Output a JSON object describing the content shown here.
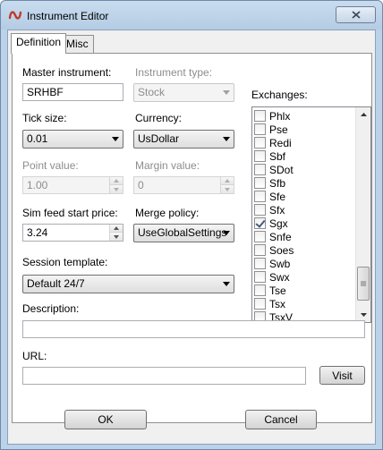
{
  "window": {
    "title": "Instrument Editor",
    "close_label": "X"
  },
  "tabs": [
    {
      "label": "Definition",
      "active": true
    },
    {
      "label": "Misc",
      "active": false
    }
  ],
  "fields": {
    "master_instrument": {
      "label": "Master instrument:",
      "value": "SRHBF"
    },
    "instrument_type": {
      "label": "Instrument type:",
      "value": "Stock"
    },
    "tick_size": {
      "label": "Tick size:",
      "value": "0.01"
    },
    "currency": {
      "label": "Currency:",
      "value": "UsDollar"
    },
    "point_value": {
      "label": "Point value:",
      "value": "1.00"
    },
    "margin_value": {
      "label": "Margin value:",
      "value": "0"
    },
    "sim_feed_start_price": {
      "label": "Sim feed start price:",
      "value": "3.24"
    },
    "merge_policy": {
      "label": "Merge policy:",
      "value": "UseGlobalSettings"
    },
    "session_template": {
      "label": "Session template:",
      "value": "Default 24/7"
    },
    "description": {
      "label": "Description:",
      "value": ""
    },
    "url": {
      "label": "URL:",
      "value": ""
    }
  },
  "exchanges": {
    "label": "Exchanges:",
    "items": [
      {
        "name": "Phlx",
        "checked": false
      },
      {
        "name": "Pse",
        "checked": false
      },
      {
        "name": "Redi",
        "checked": false
      },
      {
        "name": "Sbf",
        "checked": false
      },
      {
        "name": "SDot",
        "checked": false
      },
      {
        "name": "Sfb",
        "checked": false
      },
      {
        "name": "Sfe",
        "checked": false
      },
      {
        "name": "Sfx",
        "checked": false
      },
      {
        "name": "Sgx",
        "checked": true
      },
      {
        "name": "Snfe",
        "checked": false
      },
      {
        "name": "Soes",
        "checked": false
      },
      {
        "name": "Swb",
        "checked": false
      },
      {
        "name": "Swx",
        "checked": false
      },
      {
        "name": "Tse",
        "checked": false
      },
      {
        "name": "Tsx",
        "checked": false
      },
      {
        "name": "TsxV",
        "checked": false
      }
    ]
  },
  "buttons": {
    "visit": "Visit",
    "ok": "OK",
    "cancel": "Cancel"
  },
  "colors": {
    "accent_icon": "#c0392b",
    "titlebar": "#bcd2e8",
    "disabled_text": "#8d8d8d"
  }
}
